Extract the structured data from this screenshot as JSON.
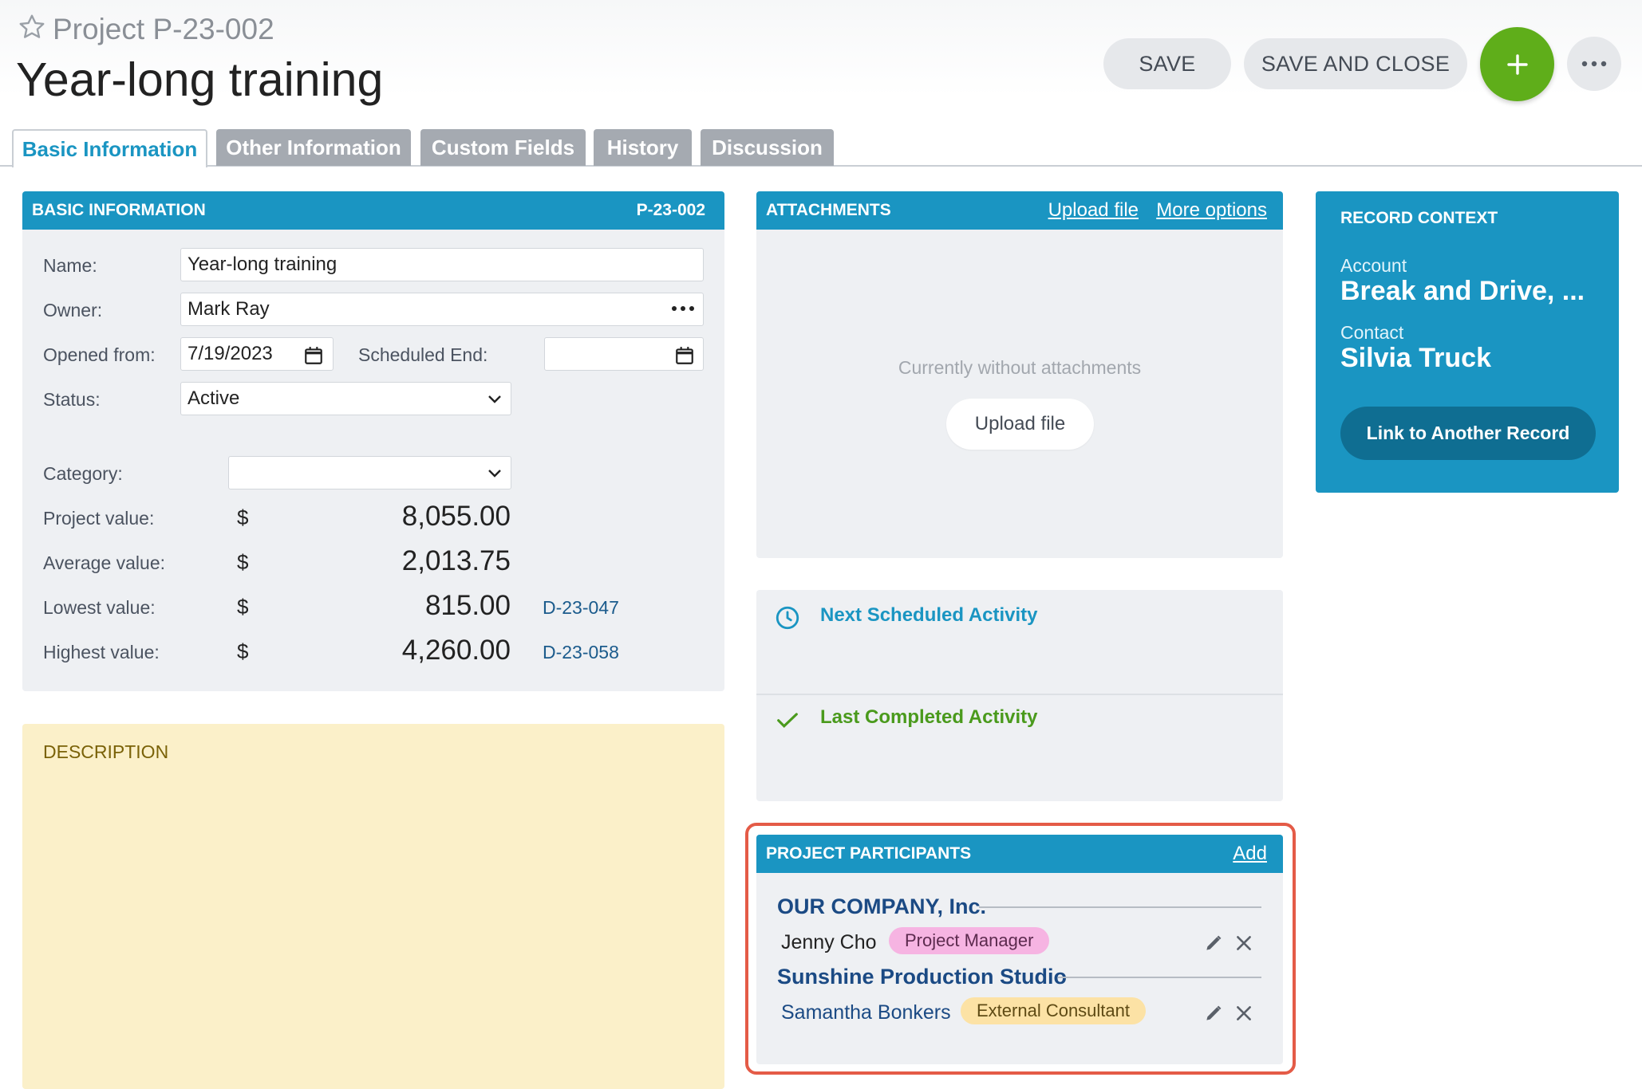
{
  "header": {
    "record_type": "Project",
    "record_code": "P-23-002",
    "title": "Year-long training",
    "save_label": "SAVE",
    "save_close_label": "SAVE AND CLOSE"
  },
  "tabs": [
    {
      "label": "Basic Information",
      "active": true
    },
    {
      "label": "Other Information",
      "active": false
    },
    {
      "label": "Custom Fields",
      "active": false
    },
    {
      "label": "History",
      "active": false
    },
    {
      "label": "Discussion",
      "active": false
    }
  ],
  "basic_info": {
    "heading": "BASIC INFORMATION",
    "code": "P-23-002",
    "name_label": "Name:",
    "name_value": "Year-long training",
    "owner_label": "Owner:",
    "owner_value": "Mark Ray",
    "opened_label": "Opened from:",
    "opened_value": "7/19/2023",
    "scheduled_end_label": "Scheduled End:",
    "scheduled_end_value": "",
    "status_label": "Status:",
    "status_value": "Active",
    "category_label": "Category:",
    "category_value": "",
    "project_value_label": "Project value:",
    "project_value": "8,055.00",
    "average_value_label": "Average value:",
    "average_value": "2,013.75",
    "lowest_value_label": "Lowest value:",
    "lowest_value": "815.00",
    "lowest_ref": "D-23-047",
    "highest_value_label": "Highest value:",
    "highest_value": "4,260.00",
    "highest_ref": "D-23-058",
    "currency": "$"
  },
  "description": {
    "heading": "DESCRIPTION"
  },
  "attachments": {
    "heading": "ATTACHMENTS",
    "upload_link": "Upload file",
    "more_link": "More options",
    "empty_text": "Currently without attachments",
    "upload_button": "Upload file"
  },
  "activities": {
    "next_label": "Next Scheduled Activity",
    "last_label": "Last Completed Activity"
  },
  "participants": {
    "heading": "PROJECT PARTICIPANTS",
    "add_link": "Add",
    "groups": [
      {
        "company": "OUR COMPANY, Inc.",
        "person": "Jenny Cho",
        "role": "Project Manager"
      },
      {
        "company": "Sunshine Production Studio",
        "person": "Samantha Bonkers",
        "role": "External Consultant"
      }
    ]
  },
  "record_context": {
    "heading": "RECORD CONTEXT",
    "account_label": "Account",
    "account_value": "Break and Drive, ...",
    "contact_label": "Contact",
    "contact_value": "Silvia Truck",
    "link_button": "Link to Another Record"
  },
  "colors": {
    "accent": "#1a95c2",
    "add_button": "#5fae1a",
    "highlight_outline": "#e45b47",
    "description_bg": "#fbf0c9",
    "role_badge_pm": "#f6b4e2",
    "role_badge_ec": "#fce2a5"
  },
  "icons": [
    "star-icon",
    "plus-icon",
    "more-icon",
    "calendar-icon",
    "chevron-down-icon",
    "clock-icon",
    "check-icon",
    "pencil-icon",
    "close-icon"
  ]
}
